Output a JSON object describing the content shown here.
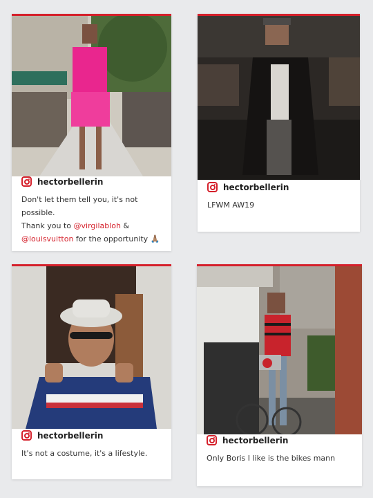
{
  "colors": {
    "accent": "#d5202b",
    "background": "#e9eaec"
  },
  "posts": [
    {
      "handle": "hectorbellerin",
      "icon": "instagram-icon",
      "caption_lines": [
        [
          {
            "t": "Don't let them tell you, it's not possible."
          }
        ],
        [
          {
            "t": "Thank you to "
          },
          {
            "t": "@virgilabloh",
            "mention": true
          },
          {
            "t": " &"
          }
        ],
        [
          {
            "t": "@louisvuitton",
            "mention": true
          },
          {
            "t": " for the opportunity 🙏🏽"
          }
        ]
      ]
    },
    {
      "handle": "hectorbellerin",
      "icon": "instagram-icon",
      "caption_lines": [
        [
          {
            "t": "LFWM AW19"
          }
        ]
      ]
    },
    {
      "handle": "hectorbellerin",
      "icon": "instagram-icon",
      "caption_lines": [
        [
          {
            "t": "It's not a costume, it's a lifestyle."
          }
        ]
      ]
    },
    {
      "handle": "hectorbellerin",
      "icon": "instagram-icon",
      "caption_lines": [
        [
          {
            "t": "Only Boris I like is the bikes mann"
          }
        ]
      ]
    }
  ]
}
